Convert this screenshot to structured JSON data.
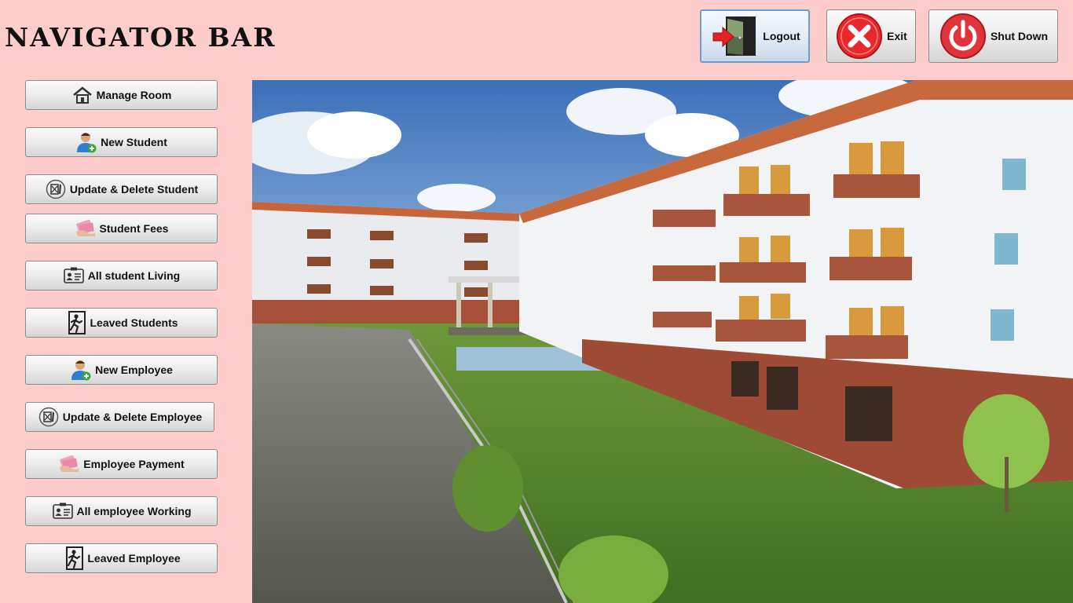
{
  "title": "NAVIGATOR BAR",
  "top_buttons": {
    "logout": "Logout",
    "exit": "Exit",
    "shutdown": "Shut Down"
  },
  "nav": [
    {
      "label": "Manage Room",
      "icon": "home-icon"
    },
    {
      "label": "New Student",
      "icon": "user-add-icon"
    },
    {
      "label": "Update & Delete Student",
      "icon": "edit-delete-icon"
    },
    {
      "label": "Student Fees",
      "icon": "money-icon"
    },
    {
      "label": "All student Living",
      "icon": "id-card-icon"
    },
    {
      "label": "Leaved Students",
      "icon": "exit-run-icon"
    },
    {
      "label": "New Employee",
      "icon": "user-add-icon"
    },
    {
      "label": "Update & Delete Employee",
      "icon": "edit-delete-icon"
    },
    {
      "label": "Employee Payment",
      "icon": "money-icon"
    },
    {
      "label": "All employee Working",
      "icon": "id-card-icon"
    },
    {
      "label": "Leaved Employee",
      "icon": "exit-run-icon"
    }
  ],
  "colors": {
    "background": "#ffcccc",
    "exit_red": "#e8282b",
    "shutdown_red": "#e0333a"
  }
}
